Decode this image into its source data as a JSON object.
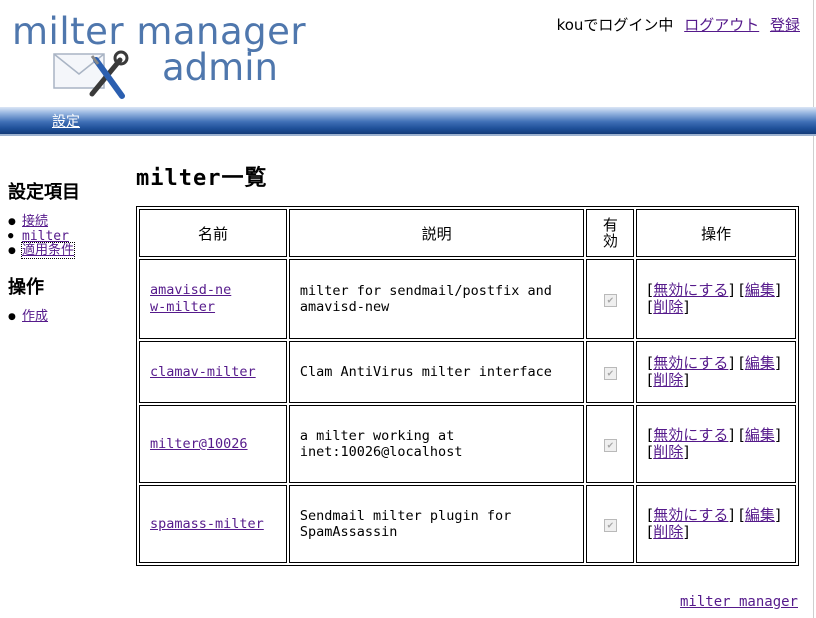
{
  "logo": {
    "line1": "milter manager",
    "line2": "admin"
  },
  "userbar": {
    "user": "kouでログイン中",
    "logout": "ログアウト",
    "register": "登録"
  },
  "nav": {
    "settings": "設定"
  },
  "sidebar": {
    "heading": "設定項目",
    "items": [
      {
        "label": "接続"
      },
      {
        "label": "milter"
      },
      {
        "label": "適用条件"
      }
    ],
    "ops_heading": "操作",
    "ops_items": [
      {
        "label": "作成"
      }
    ]
  },
  "main": {
    "title": "milter一覧",
    "columns": [
      "名前",
      "説明",
      "有効",
      "操作"
    ],
    "rows": [
      {
        "name": "amavisd-new-milter",
        "description": "milter for sendmail/postfix and amavisd-new",
        "enabled": true
      },
      {
        "name": "clamav-milter",
        "description": "Clam AntiVirus milter interface",
        "enabled": true
      },
      {
        "name": "milter@10026",
        "description": "a milter working at inet:10026@localhost",
        "enabled": true
      },
      {
        "name": "spamass-milter",
        "description": "Sendmail milter plugin for SpamAssassin",
        "enabled": true
      }
    ],
    "actions": {
      "disable": "無効にする",
      "edit": "編集",
      "delete": "削除"
    }
  },
  "footer": {
    "link": "milter manager"
  },
  "colors": {
    "logo": "#4f77ad",
    "navbar": "#2a5aa5",
    "link": "#551a8b"
  }
}
